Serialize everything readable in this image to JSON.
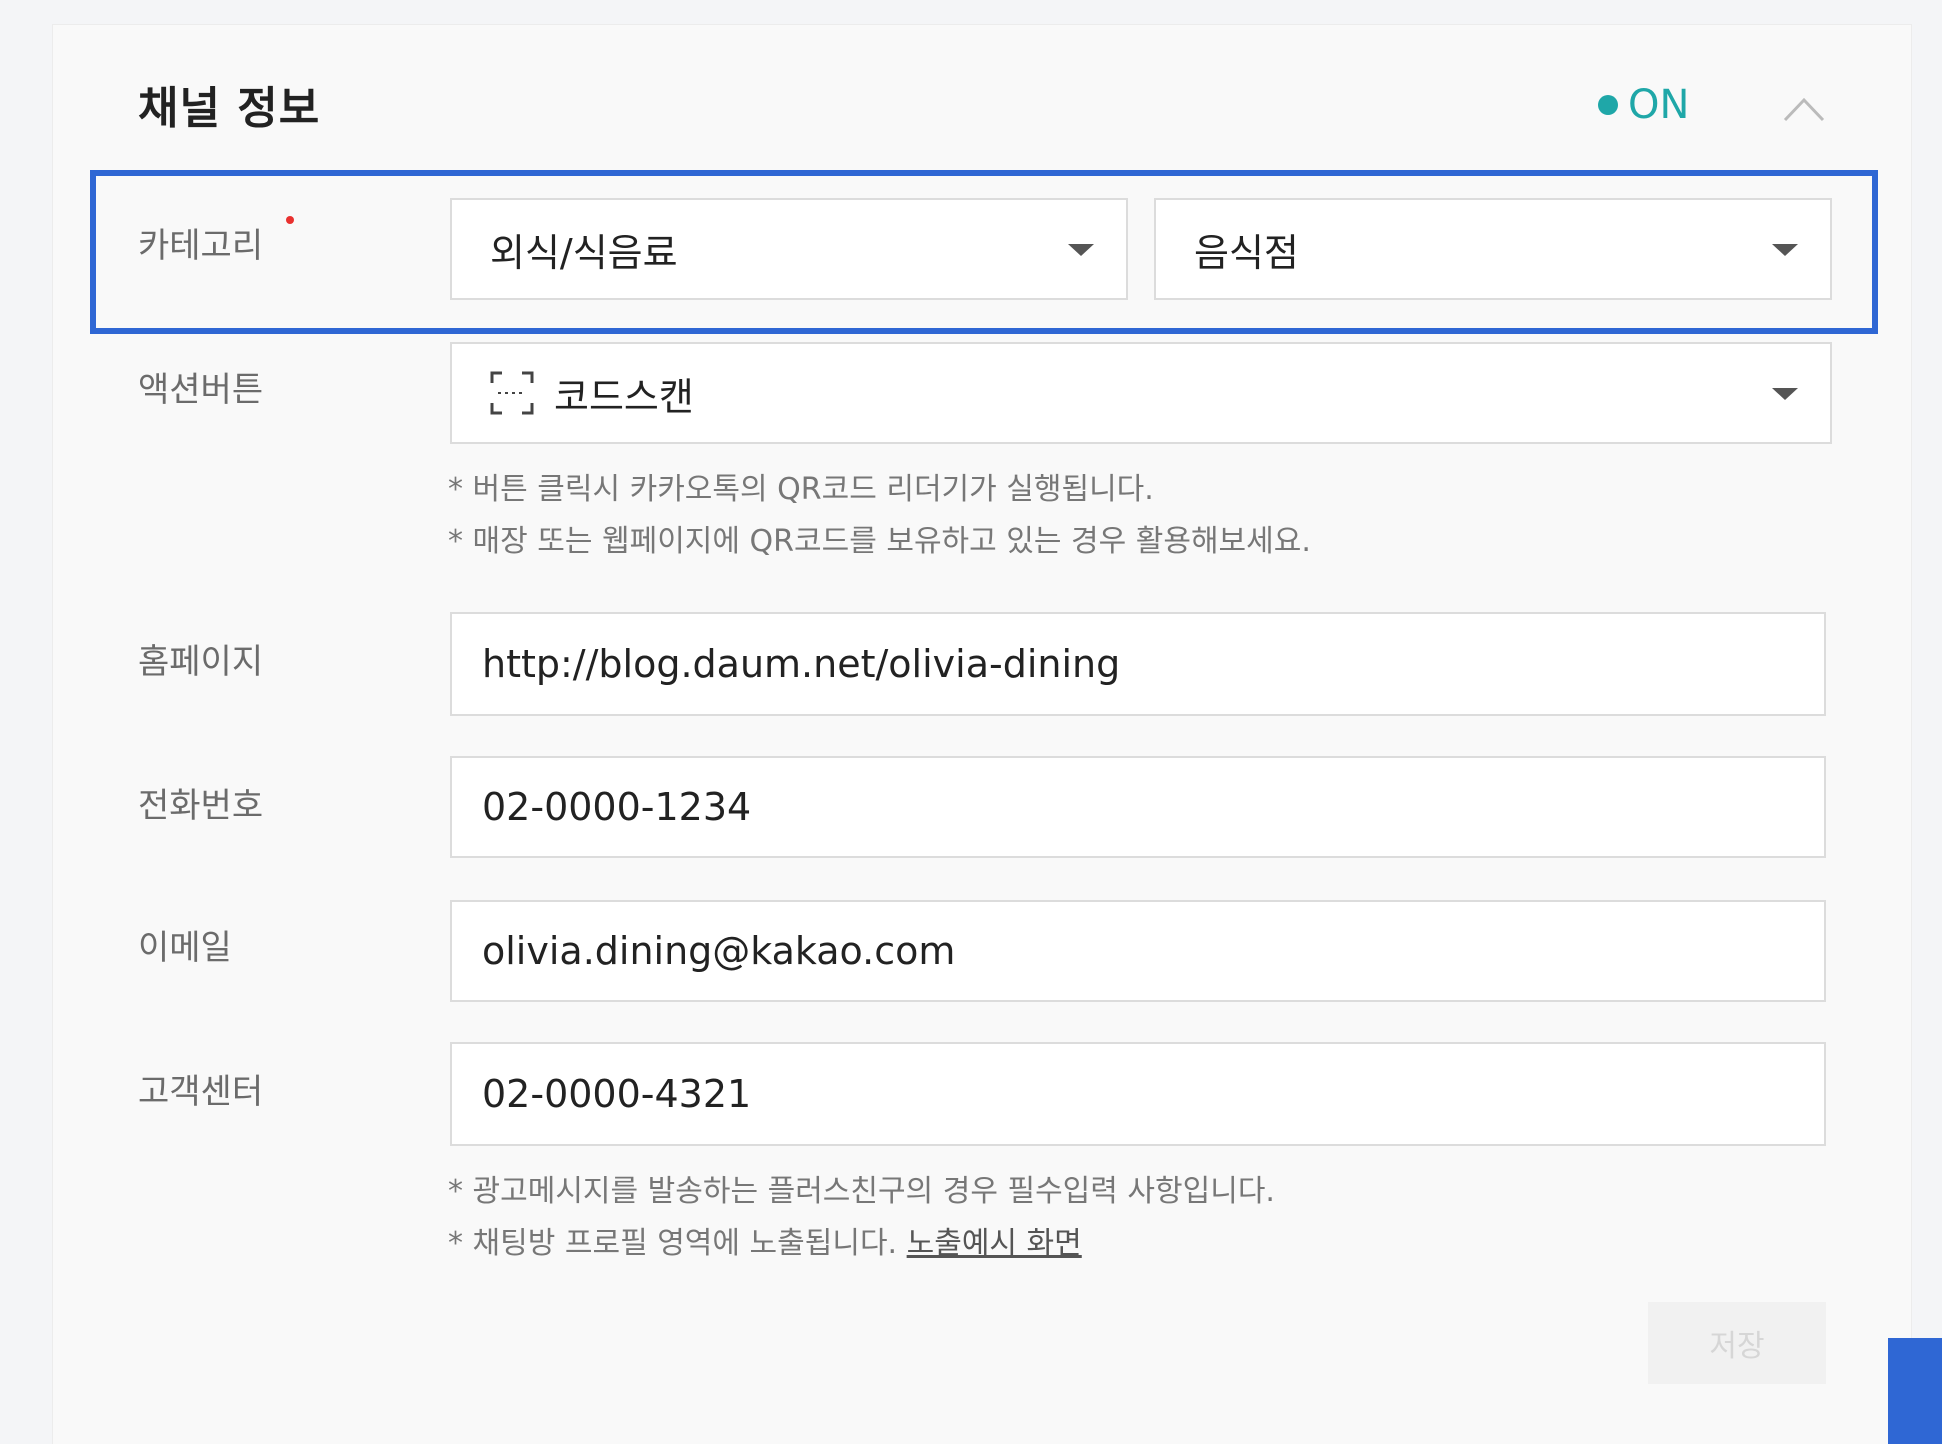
{
  "panel": {
    "title": "채널 정보",
    "status_label": "ON",
    "status_color": "#1fa7a8",
    "collapse_icon": "chevron-up-icon"
  },
  "highlight_color": "#2f67d4",
  "category": {
    "label": "카테고리",
    "required": true,
    "primary_value": "외식/식음료",
    "secondary_value": "음식점"
  },
  "action_button": {
    "label": "액션버튼",
    "icon": "qr-scan-icon",
    "value": "코드스캔",
    "hints": [
      "* 버튼 클릭시 카카오톡의 QR코드 리더기가 실행됩니다.",
      "* 매장 또는 웹페이지에 QR코드를 보유하고 있는 경우 활용해보세요."
    ]
  },
  "homepage": {
    "label": "홈페이지",
    "value": "http://blog.daum.net/olivia-dining"
  },
  "phone": {
    "label": "전화번호",
    "value": "02-0000-1234"
  },
  "email": {
    "label": "이메일",
    "value": "olivia.dining@kakao.com"
  },
  "customer_center": {
    "label": "고객센터",
    "value": "02-0000-4321",
    "hint_1": "* 광고메시지를 발송하는 플러스친구의 경우 필수입력 사항입니다.",
    "hint_2_prefix": "* 채팅방 프로필 영역에 노출됩니다. ",
    "hint_2_link": "노출예시 화면"
  },
  "save_label": "저장"
}
